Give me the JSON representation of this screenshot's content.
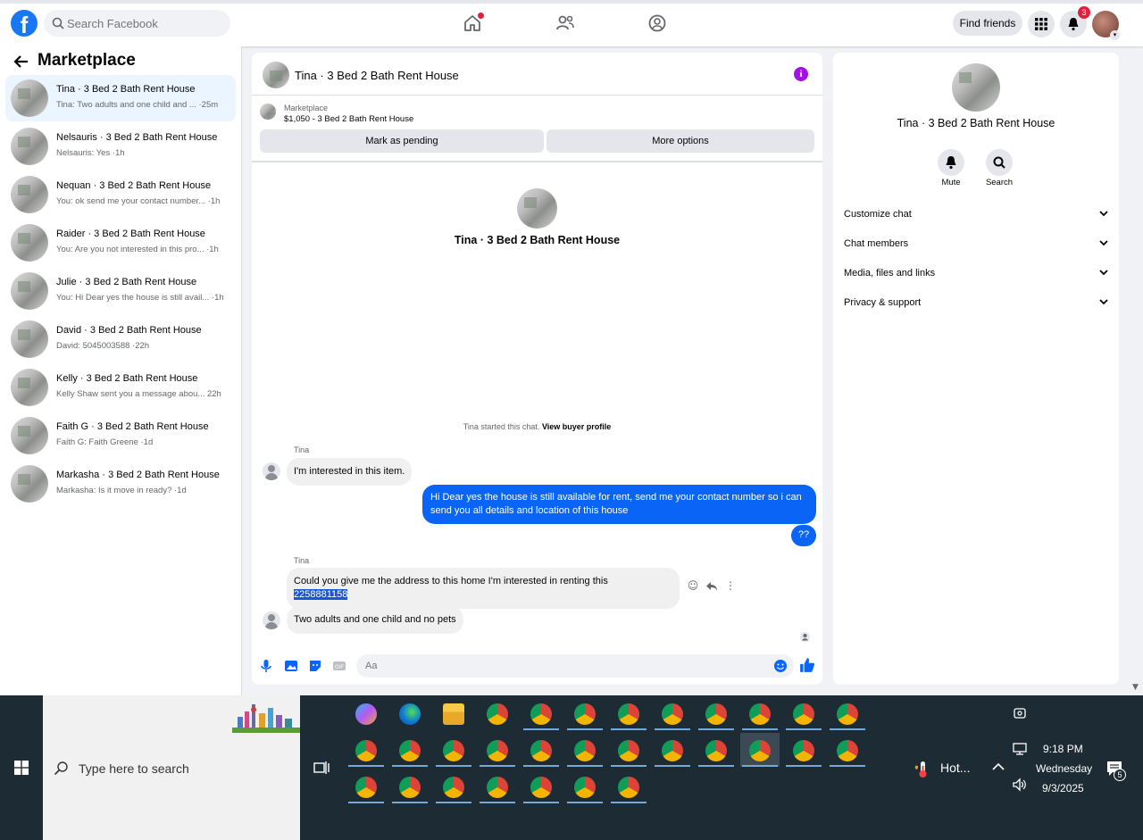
{
  "topbar": {
    "logo": "f",
    "search_placeholder": "Search Facebook",
    "find_friends": "Find friends",
    "notification_count": "3"
  },
  "sidebar": {
    "title": "Marketplace",
    "threads": [
      {
        "name": "Tina · 3 Bed 2 Bath Rent House",
        "preview": "Tina: Two adults and one child and ... ·25m"
      },
      {
        "name": "Nelsauris · 3 Bed 2 Bath Rent House",
        "preview": "Nelsauris: Yes ·1h"
      },
      {
        "name": "Nequan · 3 Bed 2 Bath Rent House",
        "preview": "You: ok send me your contact number... ·1h"
      },
      {
        "name": "Raider · 3 Bed 2 Bath Rent House",
        "preview": "You: Are you not interested in this pro... ·1h"
      },
      {
        "name": "Julie · 3 Bed 2 Bath Rent House",
        "preview": "You: Hi Dear yes the house is still avail... ·1h"
      },
      {
        "name": "David · 3 Bed 2 Bath Rent House",
        "preview": "David: 5045003588 ·22h"
      },
      {
        "name": "Kelly · 3 Bed 2 Bath Rent House",
        "preview": "Kelly Shaw sent you a message abou... 22h"
      },
      {
        "name": "Faith G · 3 Bed 2 Bath Rent House",
        "preview": "Faith G: Faith Greene ·1d"
      },
      {
        "name": "Markasha · 3 Bed 2 Bath Rent House",
        "preview": "Markasha: Is it move in ready? ·1d"
      }
    ]
  },
  "chat": {
    "title": "Tina · 3 Bed 2 Bath Rent House",
    "listing_category": "Marketplace",
    "listing_price": "$1,050 - 3 Bed 2 Bath Rent House",
    "mark_pending": "Mark as pending",
    "more_options": "More options",
    "center_title": "Tina · 3 Bed 2 Bath Rent House",
    "started_text": "Tina started this chat.",
    "view_profile": "View buyer profile",
    "sender1": "Tina",
    "msg1": "I'm interested in this item.",
    "out1": "Hi Dear yes the house is still available for rent, send me your contact number so i can send you all details and location of this house",
    "out2": "??",
    "sender2": "Tina",
    "msg2a": "Could you give me the address to this home I'm interested in renting this",
    "msg2b": "2258881158",
    "msg3": "Two adults and one child and no pets",
    "composer_placeholder": "Aa"
  },
  "rpanel": {
    "title": "Tina · 3 Bed 2 Bath Rent House",
    "mute": "Mute",
    "search": "Search",
    "rows": [
      "Customize chat",
      "Chat members",
      "Media, files and links",
      "Privacy & support"
    ]
  },
  "taskbar": {
    "search_placeholder": "Type here to search",
    "weather": "Hot...",
    "time": "9:18 PM",
    "day": "Wednesday",
    "date": "9/3/2025",
    "notif_count": "5"
  }
}
